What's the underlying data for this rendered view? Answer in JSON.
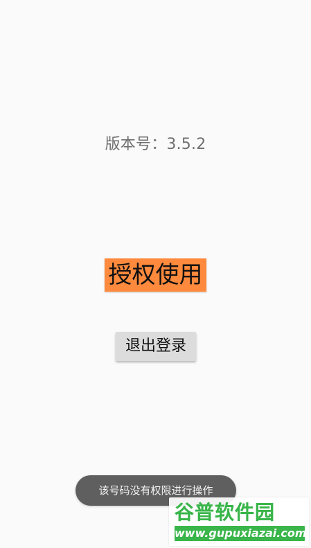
{
  "screen": {
    "version_text": "版本号：3.5.2",
    "authorize_button_label": "授权使用",
    "logout_button_label": "退出登录",
    "toast_message": "该号码没有权限进行操作"
  },
  "watermark": {
    "brand_name": "谷普软件园",
    "brand_url": "www.gupuxiazai.com"
  },
  "colors": {
    "background": "#fafafa",
    "version_text": "#6f6f6f",
    "authorize_button": "#ff8a3d",
    "logout_button": "#dcdcdc",
    "toast": "#5f5f5f",
    "watermark_green": "#39b54a"
  }
}
